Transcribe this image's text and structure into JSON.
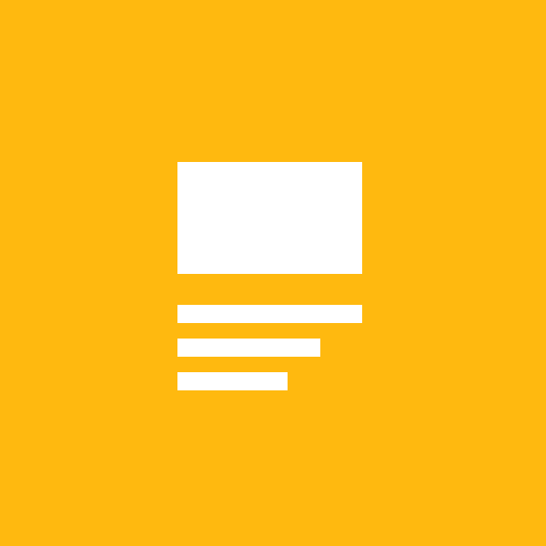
{
  "tile": {
    "background_color": "#FFB90F",
    "icon": {
      "name": "notes-app-icon",
      "foreground_color": "#FFFFFF"
    }
  }
}
